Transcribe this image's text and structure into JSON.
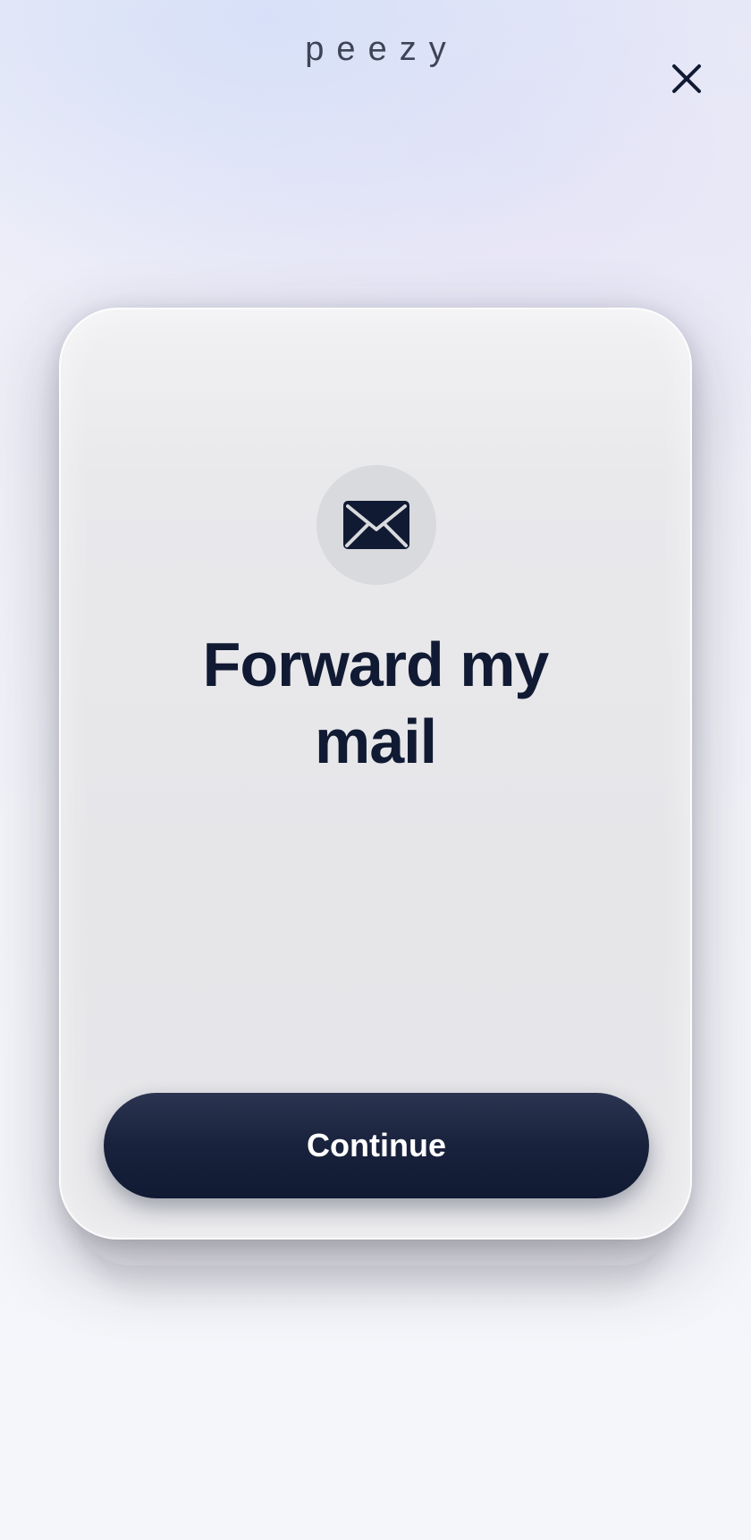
{
  "header": {
    "brand": "peezy",
    "close_icon": "close-icon"
  },
  "card": {
    "icon": "mail-icon",
    "title_line1": "Forward my",
    "title_line2": "mail",
    "continue_label": "Continue"
  },
  "colors": {
    "navy": "#111a33",
    "card_bg": "#e7e7ea",
    "icon_circle": "#d9dadd",
    "page_bg": "#f4f5fa"
  }
}
